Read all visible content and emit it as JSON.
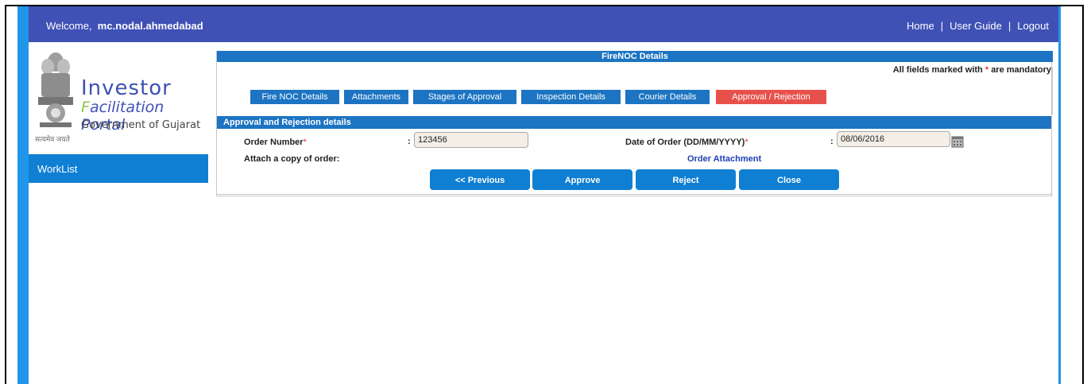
{
  "header": {
    "welcome_label": "Welcome,",
    "username": "mc.nodal.ahmedabad",
    "links": {
      "home": "Home",
      "user_guide": "User Guide",
      "logout": "Logout"
    },
    "separator": "|"
  },
  "logo": {
    "line1": "Investor",
    "line2_first": "F",
    "line2_rest": "acilitation Portal",
    "line3": "Government of Gujarat",
    "motto": "सत्यमेव जयते"
  },
  "sidebar": {
    "worklist": "WorkList"
  },
  "panel": {
    "title": "FireNOC Details",
    "mandatory_prefix": "All fields marked with",
    "mandatory_star": "*",
    "mandatory_suffix": "are mandatory",
    "tabs": [
      {
        "label": "Fire NOC Details",
        "active": false
      },
      {
        "label": "Attachments",
        "active": false
      },
      {
        "label": "Stages of Approval",
        "active": false
      },
      {
        "label": "Inspection Details",
        "active": false
      },
      {
        "label": "Courier Details",
        "active": false
      },
      {
        "label": "Approval / Rejection",
        "active": true
      }
    ],
    "section_title": "Approval and Rejection details",
    "form": {
      "order_number_label": "Order Number",
      "order_number_value": "123456",
      "date_label": "Date of Order (DD/MM/YYYY)",
      "date_value": "08/06/2016",
      "required_star": "*",
      "colon": ":",
      "attach_label": "Attach a copy of order:",
      "attach_link": "Order Attachment"
    },
    "buttons": {
      "previous": "<< Previous",
      "approve": "Approve",
      "reject": "Reject",
      "close": "Close"
    }
  },
  "colors": {
    "header_bg": "#3f51b5",
    "accent_blue": "#1c74c2",
    "active_tab": "#e8514b",
    "button_bg": "#0f7fd4"
  },
  "icons": {
    "calendar": "calendar-icon",
    "emblem": "ashoka-emblem-icon"
  }
}
